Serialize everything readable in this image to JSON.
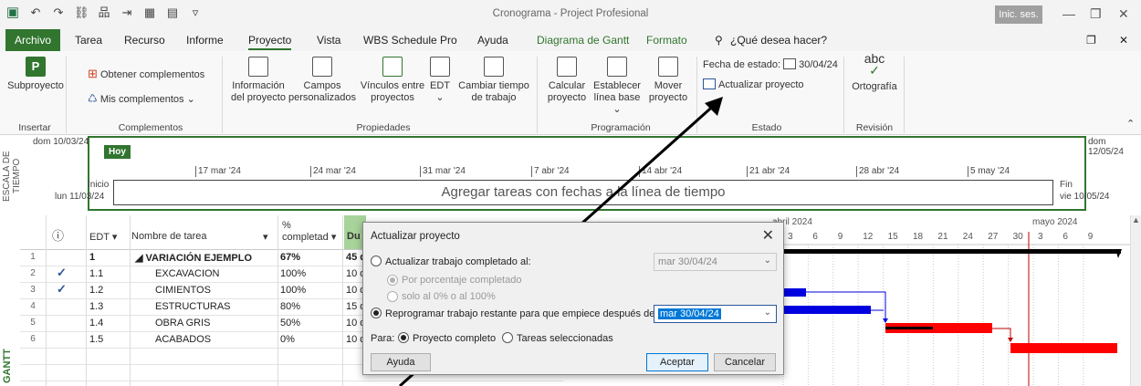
{
  "window": {
    "title": "Cronograma  -  Project Profesional",
    "signin": "Inic. ses."
  },
  "tabs": {
    "archivo": "Archivo",
    "tarea": "Tarea",
    "recurso": "Recurso",
    "informe": "Informe",
    "proyecto": "Proyecto",
    "vista": "Vista",
    "wbs": "WBS Schedule Pro",
    "ayuda": "Ayuda",
    "gantt": "Diagrama de Gantt",
    "formato": "Formato",
    "tell": "¿Qué desea hacer?"
  },
  "ribbon": {
    "subproyecto": "Subproyecto",
    "insertar": "Insertar",
    "obtener": "Obtener complementos",
    "mis": "Mis complementos",
    "complementos": "Complementos",
    "info1": "Información",
    "info2": "del proyecto",
    "campos1": "Campos",
    "campos2": "personalizados",
    "vinc1": "Vínculos entre",
    "vinc2": "proyectos",
    "edt": "EDT",
    "cambiar1": "Cambiar tiempo",
    "cambiar2": "de trabajo",
    "propiedades": "Propiedades",
    "calc1": "Calcular",
    "calc2": "proyecto",
    "est1": "Establecer",
    "est2": "línea base",
    "mover1": "Mover",
    "mover2": "proyecto",
    "programacion": "Programación",
    "fecha_label": "Fecha de estado:",
    "fecha_value": "30/04/24",
    "actualizar": "Actualizar proyecto",
    "estado": "Estado",
    "abc": "abc",
    "ortografia": "Ortografía",
    "revision": "Revisión"
  },
  "timeline": {
    "vertical_label": "ESCALA DE TIEMPO",
    "start_top": "dom 10/03/24",
    "end_top": "dom 12/05/24",
    "today": "Hoy",
    "inicio": "Inicio",
    "inicio_date": "lun 11/03/24",
    "fin": "Fin",
    "fin_date": "vie 10/05/24",
    "placeholder": "Agregar tareas con fechas a la línea de tiempo",
    "ticks": [
      "17 mar '24",
      "24 mar '24",
      "31 mar '24",
      "7 abr '24",
      "14 abr '24",
      "21 abr '24",
      "28 abr '24",
      "5 may '24"
    ]
  },
  "grid": {
    "gantt_label": "GANTT",
    "headers": {
      "info": "ⓘ",
      "edt": "EDT",
      "nombre": "Nombre de tarea",
      "pct1": "%",
      "pct2": "completad",
      "dur": "Du"
    },
    "rows": [
      {
        "num": "1",
        "check": "",
        "edt": "1",
        "name": "◢ VARIACIÓN EJEMPLO",
        "pct": "67%",
        "dur": "45 d"
      },
      {
        "num": "2",
        "check": "✓",
        "edt": "1.1",
        "name": "EXCAVACION",
        "pct": "100%",
        "dur": "10 d"
      },
      {
        "num": "3",
        "check": "✓",
        "edt": "1.2",
        "name": "CIMIENTOS",
        "pct": "100%",
        "dur": "10 d"
      },
      {
        "num": "4",
        "check": "",
        "edt": "1.3",
        "name": "ESTRUCTURAS",
        "pct": "80%",
        "dur": "15 d"
      },
      {
        "num": "5",
        "check": "",
        "edt": "1.4",
        "name": "OBRA GRIS",
        "pct": "50%",
        "dur": "10 d"
      },
      {
        "num": "6",
        "check": "",
        "edt": "1.5",
        "name": "ACABADOS",
        "pct": "0%",
        "dur": "10 d"
      }
    ]
  },
  "chart": {
    "month1": "abril 2024",
    "month2": "mayo 2024",
    "days": [
      "3",
      "6",
      "9",
      "12",
      "15",
      "18",
      "21",
      "24",
      "27",
      "30",
      "3",
      "6",
      "9"
    ],
    "colors": {
      "summary": "#000000",
      "progress": "#0000e0",
      "critical": "#ff0000",
      "status": "#c00000"
    }
  },
  "dialog": {
    "title": "Actualizar proyecto",
    "opt1": "Actualizar trabajo completado al:",
    "opt1_date": "mar 30/04/24",
    "sub1": "Por porcentaje completado",
    "sub2": "solo al 0% o al 100%",
    "opt2": "Reprogramar trabajo restante para que empiece después de:",
    "opt2_date": "mar 30/04/24",
    "para": "Para:",
    "para1": "Proyecto completo",
    "para2": "Tareas seleccionadas",
    "ayuda": "Ayuda",
    "aceptar": "Aceptar",
    "cancelar": "Cancelar"
  }
}
